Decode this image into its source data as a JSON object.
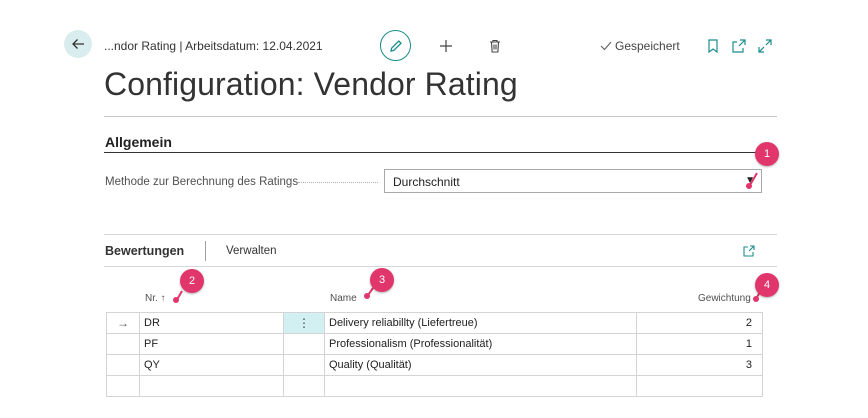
{
  "header": {
    "breadcrumb": "...ndor Rating | Arbeitsdatum: 12.04.2021",
    "saved_status": "Gespeichert",
    "page_title": "Configuration: Vendor Rating"
  },
  "general": {
    "section_title": "Allgemein",
    "method_label": "Methode zur Berechnung des Ratings",
    "method_value": "Durchschnitt"
  },
  "subpage": {
    "tab_ratings": "Bewertungen",
    "tab_manage": "Verwalten",
    "columns": {
      "nr": "Nr. ↑",
      "name": "Name",
      "weight": "Gewichtung"
    },
    "rows": [
      {
        "nr": "DR",
        "name": "Delivery reliabillty (Liefertreue)",
        "weight": "2"
      },
      {
        "nr": "PF",
        "name": "Professionalism (Professionalität)",
        "weight": "1"
      },
      {
        "nr": "QY",
        "name": "Quality (Qualität)",
        "weight": "3"
      }
    ]
  },
  "callouts": {
    "b1": "1",
    "b2": "2",
    "b3": "3",
    "b4": "4"
  },
  "colors": {
    "accent_teal": "#1b8c8c",
    "callout_pink": "#e0366b",
    "selected_cell": "#d2eff2"
  },
  "icons": {
    "back": "back-arrow-icon",
    "edit": "pencil-icon",
    "new": "plus-icon",
    "delete": "trash-icon",
    "saved": "checkmark-icon",
    "bookmark": "bookmark-icon",
    "open_new": "open-new-window-icon",
    "expand": "expand-icon",
    "share": "share-icon",
    "row_marker": "row-arrow-icon",
    "row_actions": "row-actions-icon",
    "dropdown": "chevron-down-icon"
  }
}
